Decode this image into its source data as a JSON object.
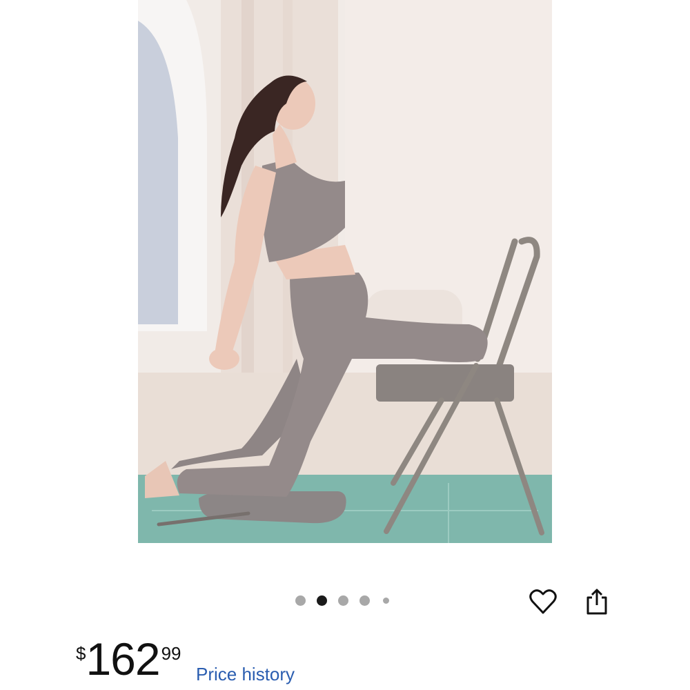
{
  "product": {
    "image_alt": "Woman stretching with folding yoga chair and kneeling pad"
  },
  "carousel": {
    "dots": [
      {
        "state": "inactive"
      },
      {
        "state": "active"
      },
      {
        "state": "inactive"
      },
      {
        "state": "inactive"
      },
      {
        "state": "small"
      }
    ]
  },
  "actions": {
    "favorite_icon": "heart-outline-icon",
    "share_icon": "share-icon"
  },
  "pricing": {
    "currency_symbol": "$",
    "dollars": "162",
    "cents": "99",
    "price_history_label": "Price history"
  },
  "colors": {
    "link": "#2a5db0",
    "dot_active": "#1a1a1a",
    "dot_inactive": "#a8a8a8"
  }
}
